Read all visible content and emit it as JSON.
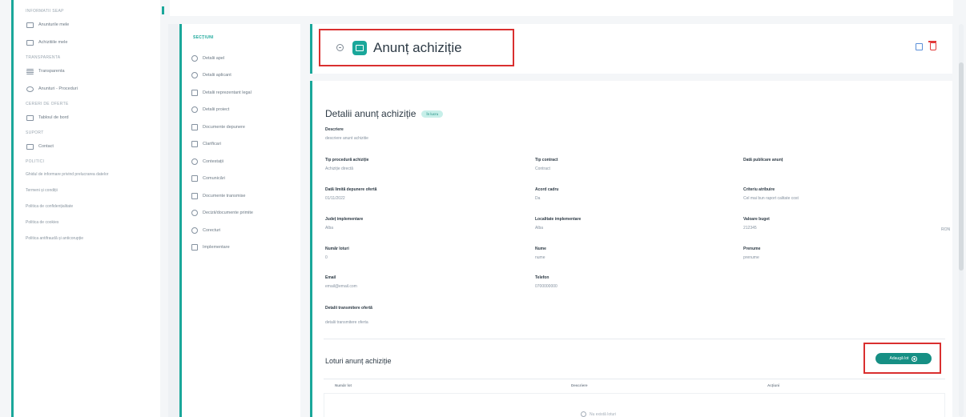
{
  "sidebar": {
    "groups": [
      {
        "heading": "INFORMATII SEAP",
        "items": [
          {
            "label": "Anunturile mele",
            "icon": "document-icon"
          },
          {
            "label": "Achizitiile mele",
            "icon": "file-icon"
          }
        ]
      },
      {
        "heading": "TRANSPARENTA",
        "items": [
          {
            "label": "Transparenta",
            "icon": "list-icon"
          },
          {
            "label": "Anunturi - Proceduri",
            "icon": "megaphone-icon"
          }
        ]
      },
      {
        "heading": "CERERI DE OFERTE",
        "items": [
          {
            "label": "Tabloul de bord",
            "icon": "dashboard-icon"
          }
        ]
      },
      {
        "heading": "SUPORT",
        "items": [
          {
            "label": "Contact",
            "icon": "mail-icon"
          }
        ]
      }
    ],
    "legal_heading": "POLITICI",
    "legal_links": [
      "Ghidul de informare privind prelucrarea datelor",
      "Termeni și condiții",
      "Politica de confidențialitate",
      "Politica de cookies",
      "Politica antifraudă și anticorupție"
    ]
  },
  "sections": {
    "title": "SECȚIUNI",
    "items": [
      "Detalii apel",
      "Detalii aplicant",
      "Detalii reprezentant legal",
      "Detalii proiect",
      "Documente depunere",
      "Clarificari",
      "Contestații",
      "Comunicări",
      "Documente transmise",
      "Decizii/documente primite",
      "Corecturi",
      "Implementare"
    ]
  },
  "header": {
    "title": "Anunț achiziție",
    "back_icon": "back-circle-icon",
    "app_icon": "announcement-icon",
    "edit_icon": "edit-icon",
    "delete_icon": "trash-icon",
    "highlight_color": "#d92f2f"
  },
  "details": {
    "title": "Detalii anunț achiziție",
    "badge": "În lucru",
    "descriere": {
      "label": "Descriere",
      "value": "descriere anunt achizitie"
    },
    "fields": [
      {
        "label": "Tip procedură achiziție",
        "value": "Achiziție directă"
      },
      {
        "label": "Tip contract",
        "value": "Contract"
      },
      {
        "label": "Dată publicare anunț",
        "value": ""
      },
      {
        "label": "Dată limită depunere ofertă",
        "value": "01/11/2022"
      },
      {
        "label": "Acord cadru",
        "value": "Da"
      },
      {
        "label": "Criteriu atribuire",
        "value": "Cel mai bun raport calitate cost"
      },
      {
        "label": "Județ implementare",
        "value": "Alba"
      },
      {
        "label": "Localitate implementare",
        "value": "Alba"
      },
      {
        "label": "Valoare buget",
        "value": "212345"
      },
      {
        "label": "Număr loturi",
        "value": "0"
      },
      {
        "label": "Nume",
        "value": "nume"
      },
      {
        "label": "Prenume",
        "value": "prenume"
      },
      {
        "label": "Email",
        "value": "email@email.com"
      },
      {
        "label": "Telefon",
        "value": "0700000000"
      }
    ],
    "currency": "RON",
    "transmitere": {
      "label": "Detalii transmitere ofertă",
      "value": "detalii transmitere oferta"
    }
  },
  "lots": {
    "title": "Loturi anunț achiziție",
    "add_button": "Adaugă lot",
    "columns": [
      "Număr lot",
      "Descriere",
      "Acțiuni"
    ],
    "empty_text": "Nu există loturi"
  },
  "colors": {
    "accent": "#1aa79a",
    "button": "#168f84"
  }
}
